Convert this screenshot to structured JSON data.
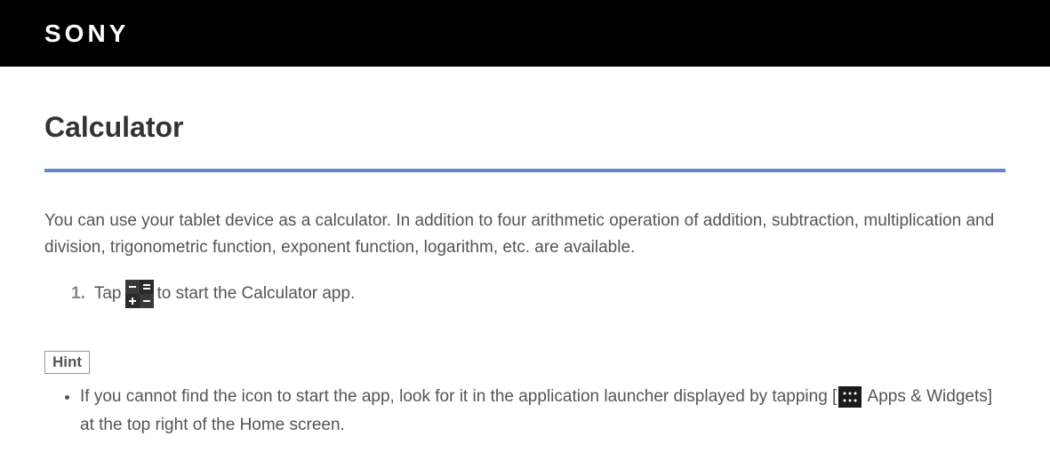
{
  "header": {
    "logo_text": "SONY"
  },
  "page": {
    "title": "Calculator",
    "intro": "You can use your tablet device as a calculator. In addition to four arithmetic operation of addition, subtraction, multiplication and division, trigonometric function, exponent function, logarithm, etc. are available."
  },
  "steps": [
    {
      "number": "1.",
      "prefix": "Tap ",
      "suffix": " to start the Calculator app."
    }
  ],
  "hint": {
    "label": "Hint",
    "items": [
      {
        "prefix": "If you cannot find the icon to start the app, look for it in the application launcher displayed by tapping [",
        "suffix": " Apps & Widgets] at the top right of the Home screen."
      }
    ]
  }
}
